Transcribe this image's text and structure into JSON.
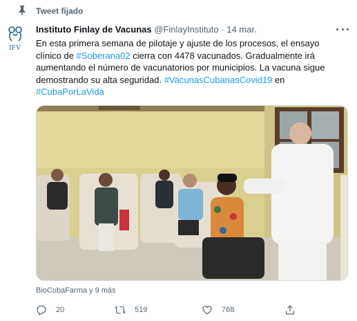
{
  "pinned": {
    "label": "Tweet fijado",
    "icon": "pin-icon"
  },
  "author": {
    "name": "Instituto Finlay de Vacunas",
    "handle": "@FinlayInstituto",
    "separator": "·",
    "date": "14 mar.",
    "avatar_text": "IFV"
  },
  "tweet": {
    "text_parts": [
      {
        "t": "En esta primera semana de pilotaje y ajuste de los procesos, el ensayo clínico de ",
        "tag": false
      },
      {
        "t": "#Soberana02",
        "tag": true
      },
      {
        "t": " cierra con 4478 vacunados. Gradualmente irá aumentando el número de vacunatorios por municipios. La vacuna sigue demostrando su alta seguridad. ",
        "tag": false
      },
      {
        "t": "#VacunasCubanasCovid19",
        "tag": true
      },
      {
        "t": " en ",
        "tag": false
      },
      {
        "t": "#CubaPorLaVida",
        "tag": true
      }
    ],
    "media_description_icon": "photo"
  },
  "liked_by": "BioCubaFarma y 9 más",
  "actions": {
    "reply": {
      "icon": "reply-icon",
      "count": "20"
    },
    "retweet": {
      "icon": "retweet-icon",
      "count": "519"
    },
    "like": {
      "icon": "like-icon",
      "count": "768"
    },
    "share": {
      "icon": "share-icon"
    }
  },
  "colors": {
    "link": "#1d9bf0",
    "muted": "#536471",
    "text": "#0f1419"
  }
}
